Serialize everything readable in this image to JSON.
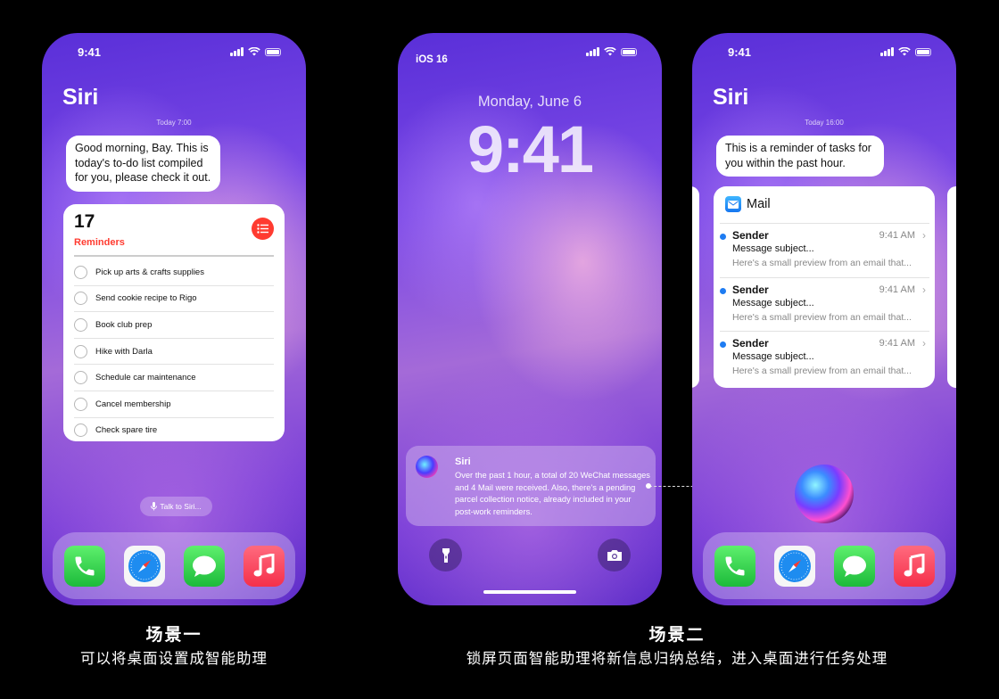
{
  "scene1": {
    "status_time": "9:41",
    "siri_title": "Siri",
    "timestamp": "Today 7:00",
    "bubble_text": "Good morning, Bay. This is today's to-do list compiled for you, please check it out.",
    "reminders": {
      "count": "17",
      "title": "Reminders",
      "items": [
        "Pick up arts & crafts supplies",
        "Send cookie recipe to Rigo",
        "Book club prep",
        "Hike with Darla",
        "Schedule car maintenance",
        "Cancel membership",
        "Check spare tire"
      ]
    },
    "talk_label": "Talk to Siri...",
    "dock_apps": [
      "phone-icon",
      "safari-icon",
      "messages-icon",
      "music-icon"
    ]
  },
  "scene2": {
    "status_label": "iOS 16",
    "lock_date": "Monday, June 6",
    "lock_time": "9:41",
    "notification": {
      "title": "Siri",
      "body": "Over the past 1 hour, a total of 20 WeChat messages and 4 Mail were received. Also, there's a pending parcel collection notice, already included in your post-work reminders."
    },
    "left_button_icon": "flashlight-icon",
    "right_button_icon": "camera-icon"
  },
  "scene3": {
    "status_time": "9:41",
    "siri_title": "Siri",
    "timestamp": "Today 16:00",
    "bubble_text": "This is a reminder of tasks for you within the past hour.",
    "mail": {
      "title": "Mail",
      "items": [
        {
          "sender": "Sender",
          "time": "9:41 AM",
          "subject": "Message subject...",
          "preview": "Here's a small preview from an email that..."
        },
        {
          "sender": "Sender",
          "time": "9:41 AM",
          "subject": "Message subject...",
          "preview": "Here's a small preview from an email that..."
        },
        {
          "sender": "Sender",
          "time": "9:41 AM",
          "subject": "Message subject...",
          "preview": "Here's a small preview from an email that..."
        }
      ]
    }
  },
  "captions": {
    "scene1_title": "场景一",
    "scene1_subtitle": "可以将桌面设置成智能助理",
    "scene2_title": "场景二",
    "scene2_subtitle": "锁屏页面智能助理将新信息归纳总结，进入桌面进行任务处理"
  },
  "colors": {
    "background": "#000000",
    "reminders_accent": "#ff3b30",
    "mail_dot": "#1e7cf2"
  }
}
